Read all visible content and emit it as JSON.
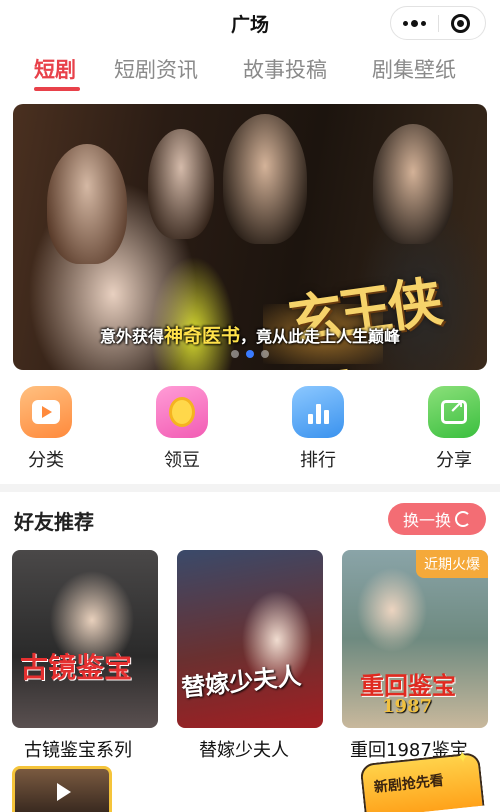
{
  "header": {
    "title": "广场",
    "more_icon": "more-dots-icon",
    "close_icon": "target-close-icon"
  },
  "tabs": [
    {
      "label": "短剧",
      "active": true
    },
    {
      "label": "短剧资讯",
      "active": false
    },
    {
      "label": "故事投稿",
      "active": false
    },
    {
      "label": "剧集壁纸",
      "active": false
    }
  ],
  "banner": {
    "drama_logo": "玄王侠医",
    "caption_before": "意外获得",
    "caption_highlight": "神奇医书",
    "caption_after": "，竟从此走上人生巅峰",
    "dot_count": 3,
    "active_dot": 1
  },
  "quick_actions": [
    {
      "label": "分类",
      "icon": "category-icon"
    },
    {
      "label": "领豆",
      "icon": "coin-icon"
    },
    {
      "label": "排行",
      "icon": "ranking-icon"
    },
    {
      "label": "分享",
      "icon": "share-icon"
    }
  ],
  "recommend": {
    "title": "好友推荐",
    "refresh_label": "换一换",
    "cards": [
      {
        "title": "古镜鉴宝系列",
        "cover_text": "古镜鉴宝",
        "badge": ""
      },
      {
        "title": "替嫁少夫人",
        "cover_text": "替嫁少夫人",
        "badge": ""
      },
      {
        "title": "重回1987鉴宝",
        "cover_text": "重回鉴宝",
        "cover_year": "1987",
        "badge": "近期火爆"
      }
    ]
  },
  "floating": {
    "promo_label": "新剧抢先看"
  },
  "colors": {
    "accent": "#e8414a",
    "refresh_bg": "#f36d74",
    "badge_bg": "#f5a93a",
    "active_dot": "#3a7bff"
  }
}
